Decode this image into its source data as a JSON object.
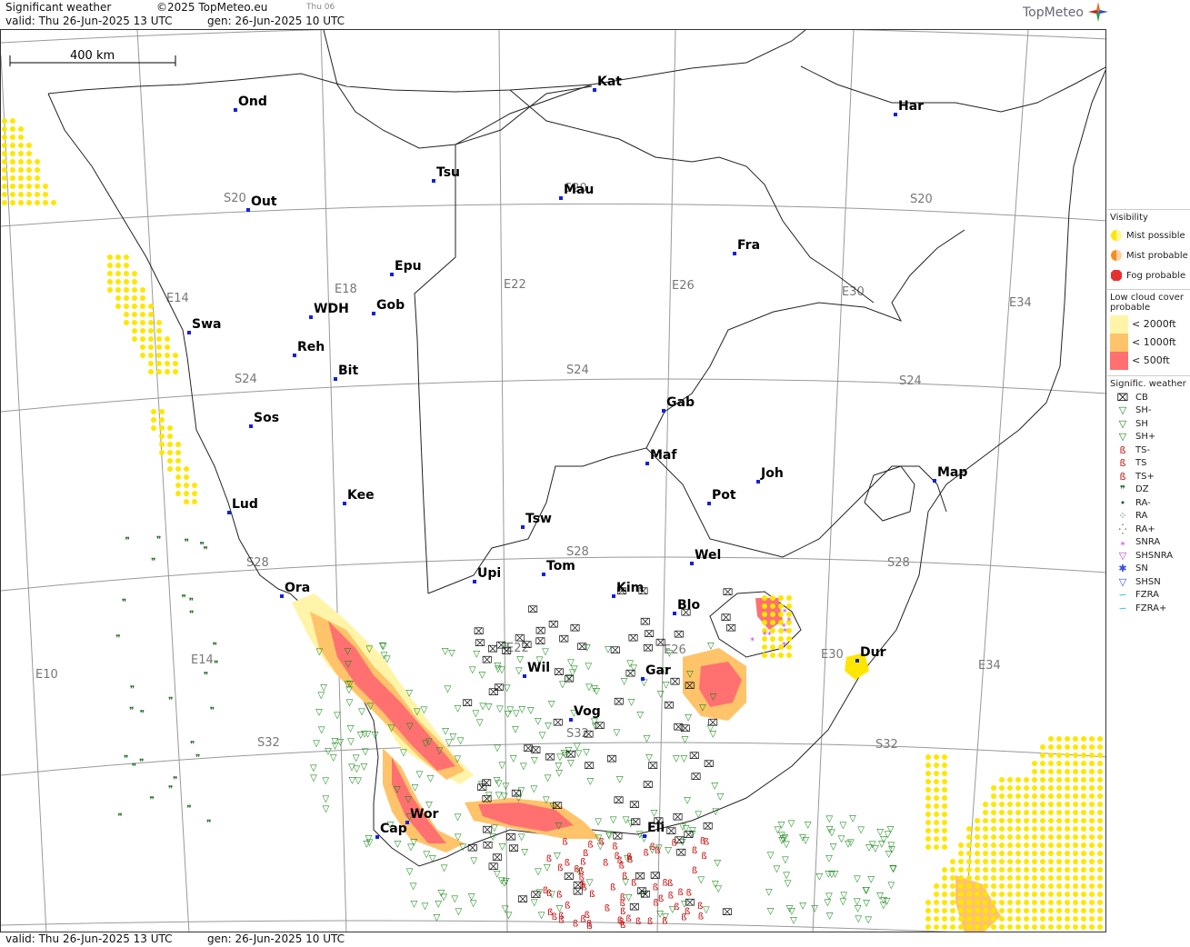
{
  "header": {
    "title": "Significant weather",
    "copyright": "©2025 TopMeteo.eu",
    "day_code": "Thu 06",
    "valid": "valid:  Thu   26-Jun-2025  13 UTC",
    "gen": "gen:  26-Jun-2025 10 UTC",
    "logo": "TopMeteo"
  },
  "footer": {
    "valid": "valid:  Thu   26-Jun-2025   13 UTC",
    "gen": "gen:  26-Jun-2025 10 UTC"
  },
  "scale_label": "400 km",
  "grid_labels": {
    "lat": [
      "S20",
      "S24",
      "S28",
      "S32"
    ],
    "lon": [
      "E10",
      "E14",
      "E18",
      "E22",
      "E26",
      "E30",
      "E34"
    ]
  },
  "cities": [
    {
      "name": "Ond"
    },
    {
      "name": "Kat"
    },
    {
      "name": "Har"
    },
    {
      "name": "Tsu"
    },
    {
      "name": "Mau"
    },
    {
      "name": "Out"
    },
    {
      "name": "Fra"
    },
    {
      "name": "Epu"
    },
    {
      "name": "WDH"
    },
    {
      "name": "Gob"
    },
    {
      "name": "Swa"
    },
    {
      "name": "Reh"
    },
    {
      "name": "Bit"
    },
    {
      "name": "Gab"
    },
    {
      "name": "Sos"
    },
    {
      "name": "Maf"
    },
    {
      "name": "Joh"
    },
    {
      "name": "Map"
    },
    {
      "name": "Kee"
    },
    {
      "name": "Pot"
    },
    {
      "name": "Lud"
    },
    {
      "name": "Tsw"
    },
    {
      "name": "Wel"
    },
    {
      "name": "Tom"
    },
    {
      "name": "Upi"
    },
    {
      "name": "Kim"
    },
    {
      "name": "Ora"
    },
    {
      "name": "Blo"
    },
    {
      "name": "Dur"
    },
    {
      "name": "Wil"
    },
    {
      "name": "Gar"
    },
    {
      "name": "Vog"
    },
    {
      "name": "Wor"
    },
    {
      "name": "Cap"
    },
    {
      "name": "Eli"
    }
  ],
  "legend": {
    "visibility_title": "Visibility",
    "visibility": [
      {
        "label": "Mist possible",
        "color": "#ffe600"
      },
      {
        "label": "Mist probable",
        "color": "#ff8c1a"
      },
      {
        "label": "Fog probable",
        "color": "#e83030"
      }
    ],
    "lowcloud_title": "Low cloud cover probable",
    "lowcloud": [
      {
        "label": "< 2000ft",
        "color": "#fff4a8"
      },
      {
        "label": "< 1000ft",
        "color": "#ffc36a"
      },
      {
        "label": "<   500ft",
        "color": "#ff7070"
      }
    ],
    "sigwx_title": "Signific. weather",
    "sigwx": [
      {
        "label": "CB",
        "icon": "cb-icon",
        "color": "#000"
      },
      {
        "label": "SH-",
        "icon": "shower-light-icon",
        "color": "#1a8a1a"
      },
      {
        "label": "SH",
        "icon": "shower-icon",
        "color": "#1a8a1a"
      },
      {
        "label": "SH+",
        "icon": "shower-heavy-icon",
        "color": "#1a8a1a"
      },
      {
        "label": "TS-",
        "icon": "thunderstorm-light-icon",
        "color": "#c81010"
      },
      {
        "label": "TS",
        "icon": "thunderstorm-icon",
        "color": "#c81010"
      },
      {
        "label": "TS+",
        "icon": "thunderstorm-heavy-icon",
        "color": "#c81010"
      },
      {
        "label": "DZ",
        "icon": "drizzle-icon",
        "color": "#1a6a1a"
      },
      {
        "label": "RA-",
        "icon": "rain-light-icon",
        "color": "#1a6a1a"
      },
      {
        "label": "RA",
        "icon": "rain-icon",
        "color": "#1a6a1a"
      },
      {
        "label": "RA+",
        "icon": "rain-heavy-icon",
        "color": "#1a6a1a"
      },
      {
        "label": "SNRA",
        "icon": "snow-rain-icon",
        "color": "#c040d0"
      },
      {
        "label": "SHSNRA",
        "icon": "shower-snow-rain-icon",
        "color": "#c040d0"
      },
      {
        "label": "SN",
        "icon": "snow-icon",
        "color": "#3050e0"
      },
      {
        "label": "SHSN",
        "icon": "shower-snow-icon",
        "color": "#3050e0"
      },
      {
        "label": "FZRA",
        "icon": "freezing-rain-icon",
        "color": "#20c0e0"
      },
      {
        "label": "FZRA+",
        "icon": "freezing-rain-heavy-icon",
        "color": "#20c0e0"
      }
    ]
  }
}
